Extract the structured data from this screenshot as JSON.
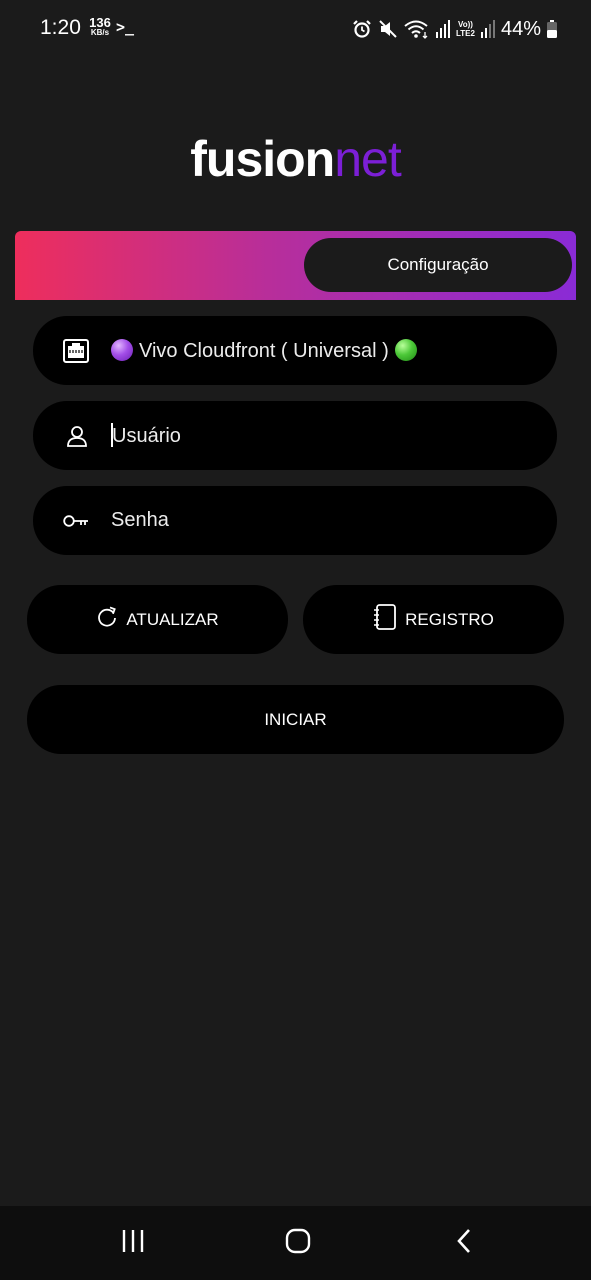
{
  "status_bar": {
    "time": "1:20",
    "net_speed_value": "136",
    "net_speed_unit": "KB/s",
    "terminal_glyph": ">_",
    "volte_label_top": "Vo))",
    "volte_label_bottom": "LTE2",
    "battery": "44%"
  },
  "logo": {
    "part1": "fusion",
    "part2": "net",
    "accent_color": "#7c1fd6"
  },
  "tabs": {
    "config_label": "Configuração",
    "gradient_colors": [
      "#ee2e5c",
      "#b82e9a",
      "#8a2bd6"
    ]
  },
  "form": {
    "server": {
      "label": "Vivo Cloudfront ( Universal )",
      "icon": "ethernet-port-icon"
    },
    "user": {
      "placeholder": "Usuário",
      "icon": "person-icon"
    },
    "password": {
      "placeholder": "Senha",
      "icon": "key-icon"
    }
  },
  "buttons": {
    "update_label": "ATUALIZAR",
    "register_label": "REGISTRO",
    "start_label": "INICIAR"
  },
  "nav": {
    "recent": "recent-apps-icon",
    "home": "home-icon",
    "back": "back-icon"
  }
}
